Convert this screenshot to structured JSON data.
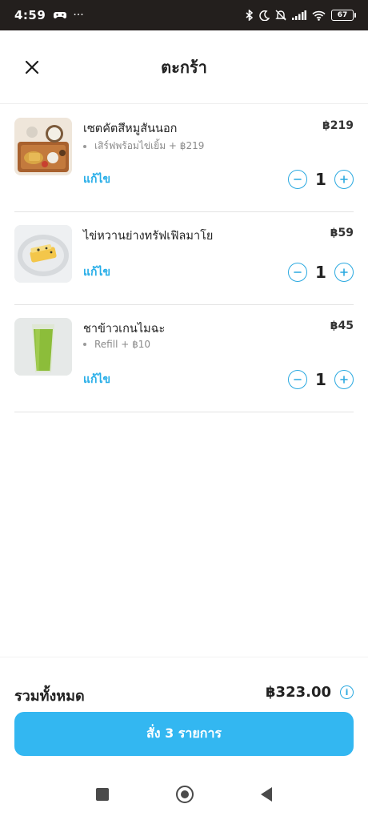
{
  "status_bar": {
    "time": "4:59",
    "dots": "···",
    "battery": "67"
  },
  "header": {
    "title": "ตะกร้า"
  },
  "items": [
    {
      "name": "เซตคัตสึหมูสันนอก",
      "price": "฿219",
      "option": "เสิร์ฟพร้อมไข่เยิ้ม + ฿219",
      "edit_label": "แก้ไข",
      "quantity": "1"
    },
    {
      "name": "ไข่หวานย่างทรัฟเฟิลมาโย",
      "price": "฿59",
      "option": "",
      "edit_label": "แก้ไข",
      "quantity": "1"
    },
    {
      "name": "ชาข้าวเกนไมฉะ",
      "price": "฿45",
      "option": "Refill + ฿10",
      "edit_label": "แก้ไข",
      "quantity": "1"
    }
  ],
  "footer": {
    "total_label": "รวมทั้งหมด",
    "total_value": "฿323.00",
    "order_button": "สั่ง 3 รายการ"
  },
  "colors": {
    "accent": "#2aa9e0",
    "order_button": "#33b7f1",
    "status_bar": "#231f1d"
  }
}
